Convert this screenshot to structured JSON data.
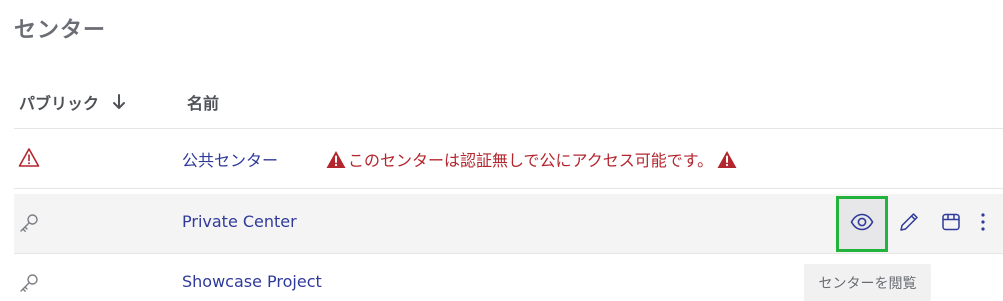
{
  "page": {
    "title": "センター"
  },
  "table": {
    "columns": {
      "public": "パブリック",
      "name": "名前"
    },
    "rows": [
      {
        "name": "公共センター",
        "icon": "warning-triangle-icon",
        "warning": "このセンターは認証無しで公にアクセス可能です。"
      },
      {
        "name": "Private Center",
        "icon": "key-icon"
      },
      {
        "name": "Showcase Project",
        "icon": "key-icon"
      }
    ]
  },
  "actions": {
    "view_icon": "eye-icon",
    "edit_icon": "pencil-icon",
    "archive_icon": "box-icon",
    "more_icon": "more-vertical-icon"
  },
  "tooltip": {
    "text": "センターを閲覧"
  },
  "colors": {
    "link": "#2f3a99",
    "warning": "#b3262e",
    "focus_outline": "#21b33c",
    "hover_row": "#f4f4f5"
  }
}
